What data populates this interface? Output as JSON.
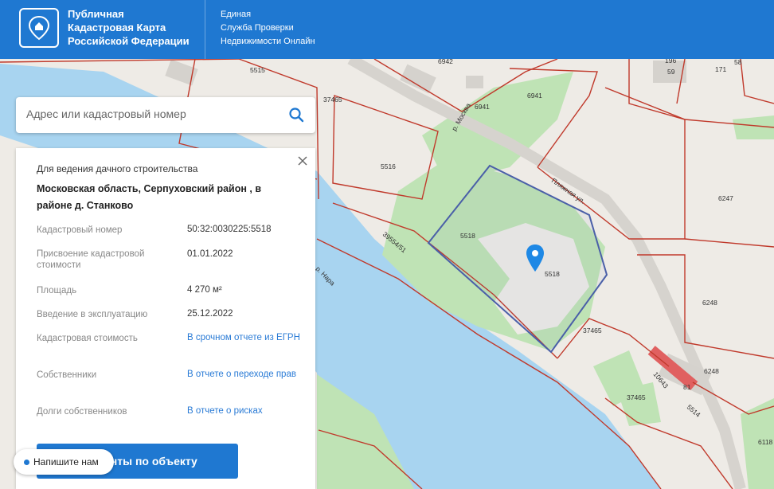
{
  "header": {
    "title_lines": [
      "Публичная",
      "Кадастровая Карта",
      "Российской Федерации"
    ],
    "service_lines": [
      "Единая",
      "Служба Проверки",
      "Недвижимости Онлайн"
    ]
  },
  "search": {
    "placeholder": "Адрес или кадастровый номер",
    "value": ""
  },
  "panel": {
    "purpose": "Для ведения дачного строительства",
    "address": "Московская область, Серпуховский район , в районе д. Станково",
    "rows": [
      {
        "label": "Кадастровый номер",
        "value": "50:32:0030225:5518"
      },
      {
        "label": "Присвоение кадастровой стоимости",
        "value": "01.01.2022"
      },
      {
        "label": "Площадь",
        "value": "4 270 м²"
      },
      {
        "label": "Введение в эксплуатацию",
        "value": "25.12.2022"
      },
      {
        "label": "Кадастровая стоимость",
        "value": "В срочном отчете из ЕГРН"
      },
      {
        "label": "Собственники",
        "value": "В отчете о переходе прав"
      },
      {
        "label": "Долги собственников",
        "value": "В отчете о рисках"
      }
    ],
    "docs_button": "енты по объекту"
  },
  "chat": {
    "label": "Напишите нам"
  },
  "map": {
    "parcel_labels": [
      "5515",
      "6942",
      "196",
      "59",
      "58",
      "171",
      "37465",
      "6941",
      "6941",
      "5516",
      "6247",
      "5518",
      "5518",
      "39554/51",
      "6248",
      "37465",
      "6248",
      "37465",
      "81",
      "5514",
      "6118",
      "10643"
    ],
    "street_label": "Пляжная ул.",
    "river_label": "р. Нара",
    "stream_label": "р. Москва",
    "colors": {
      "water": "#a8d4f0",
      "green": "#bfe3b5",
      "boundary": "#c0392b",
      "selected": "#4a5fa8",
      "pin": "#1e88e5"
    }
  }
}
